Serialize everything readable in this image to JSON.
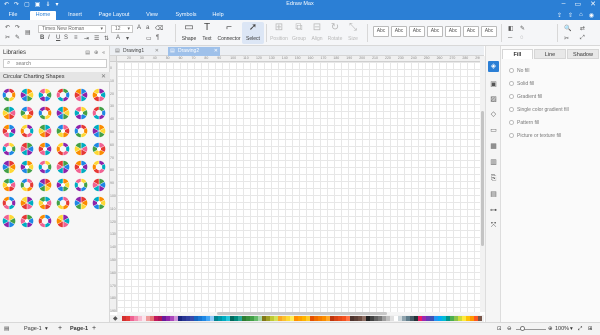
{
  "titlebar": {
    "title": "Edraw Max",
    "quick_access": [
      "↶",
      "↷",
      "▢",
      "▣",
      "⇓",
      "▾"
    ],
    "window_controls": [
      "–",
      "▭",
      "✕"
    ]
  },
  "menu": {
    "tabs": [
      {
        "label": "File",
        "active": false
      },
      {
        "label": "Home",
        "active": true
      },
      {
        "label": "Insert",
        "active": false
      },
      {
        "label": "Page Layout",
        "active": false
      },
      {
        "label": "View",
        "active": false
      },
      {
        "label": "Symbols",
        "active": false
      },
      {
        "label": "Help",
        "active": false
      }
    ],
    "right_icons": [
      "⇪",
      "⇧",
      "⌂",
      "◉"
    ]
  },
  "ribbon": {
    "font_name": "Times New Roman",
    "font_size": "12",
    "tools": [
      {
        "label": "Shape",
        "icon": "▭"
      },
      {
        "label": "Text",
        "icon": "T"
      },
      {
        "label": "Connector",
        "icon": "⌐"
      },
      {
        "label": "Select",
        "icon": "➚"
      }
    ],
    "disabled_tools": [
      "Position",
      "Group",
      "Align",
      "Rotate",
      "Size"
    ],
    "style_buttons": [
      "Abc",
      "Abc",
      "Abc",
      "Abc",
      "Abc",
      "Abc",
      "Abc"
    ],
    "format_icons": [
      "◧",
      "✎",
      "─",
      "◌"
    ],
    "edit_icons": [
      "🔍",
      "⇄",
      "✂",
      "⤢"
    ]
  },
  "libraries": {
    "title": "Libraries",
    "search_placeholder": "search",
    "category": "Circular Charting Shapes"
  },
  "documents": {
    "tabs": [
      {
        "label": "Drawing1",
        "active": false
      },
      {
        "label": "Drawing2",
        "active": true
      }
    ]
  },
  "rulers": {
    "h_ticks": [
      "20",
      "30",
      "40",
      "50",
      "60",
      "70",
      "80",
      "90",
      "100",
      "110",
      "120",
      "130",
      "140",
      "150",
      "160",
      "170",
      "180",
      "190",
      "200",
      "210",
      "220",
      "230",
      "240",
      "250",
      "260",
      "270",
      "280",
      "290"
    ],
    "v_ticks": [
      "0",
      "10",
      "20",
      "30",
      "40",
      "50",
      "60",
      "70",
      "80",
      "90",
      "100",
      "110",
      "120",
      "130",
      "140",
      "150",
      "160",
      "170",
      "180",
      "190"
    ]
  },
  "fill_panel": {
    "tabs": [
      {
        "label": "Fill",
        "active": true
      },
      {
        "label": "Line",
        "active": false
      },
      {
        "label": "Shadow",
        "active": false
      }
    ],
    "options": [
      "No fill",
      "Solid fill",
      "Gradient fill",
      "Single color gradient fill",
      "Pattern fill",
      "Picture or texture fill"
    ]
  },
  "status": {
    "page_selector": "Page-1",
    "page_tab": "Page-1",
    "add_page": "+",
    "zoom": "100%"
  },
  "colors": {
    "accent": "#2b7fd5",
    "palette": [
      "#d32f2f",
      "#e53935",
      "#f06292",
      "#f48fb1",
      "#f8bbd0",
      "#fce4ec",
      "#ef9a9a",
      "#e57373",
      "#c2185b",
      "#ad1457",
      "#6a1b9a",
      "#8e24aa",
      "#ab47bc",
      "#ce93d8",
      "#1a237e",
      "#283593",
      "#303f9f",
      "#3949ab",
      "#1565c0",
      "#1976d2",
      "#1e88e5",
      "#42a5f5",
      "#90caf9",
      "#00838f",
      "#0097a7",
      "#00acc1",
      "#26c6da",
      "#00695c",
      "#00897b",
      "#26a69a",
      "#2e7d32",
      "#388e3c",
      "#43a047",
      "#66bb6a",
      "#a5d6a7",
      "#827717",
      "#9e9d24",
      "#c0ca33",
      "#d4e157",
      "#f9a825",
      "#fbc02d",
      "#fdd835",
      "#ffee58",
      "#ff8f00",
      "#ffa000",
      "#ffb300",
      "#ffca28",
      "#e65100",
      "#ef6c00",
      "#f57c00",
      "#fb8c00",
      "#ffa726",
      "#bf360c",
      "#d84315",
      "#e64a19",
      "#f4511e",
      "#ff7043",
      "#4e342e",
      "#5d4037",
      "#6d4c41",
      "#8d6e63",
      "#212121",
      "#424242",
      "#616161",
      "#757575",
      "#9e9e9e",
      "#bdbdbd",
      "#e0e0e0",
      "#ffffff",
      "#cfd8dc",
      "#90a4ae",
      "#607d8b",
      "#455a64",
      "#263238",
      "#e91e63",
      "#9c27b0",
      "#673ab7",
      "#3f51b5",
      "#2196f3",
      "#03a9f4",
      "#00bcd4",
      "#009688",
      "#4caf50",
      "#8bc34a",
      "#cddc39",
      "#ffeb3b",
      "#ffc107",
      "#ff9800",
      "#ff5722",
      "#795548"
    ]
  }
}
